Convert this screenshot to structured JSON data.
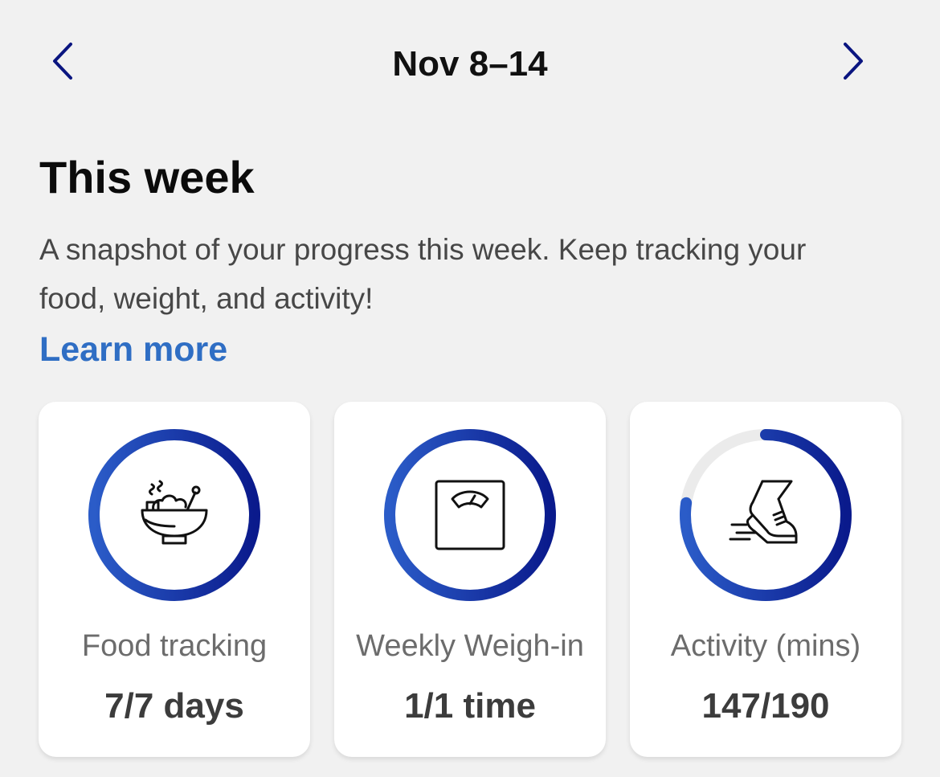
{
  "header": {
    "week_range": "Nov 8–14",
    "prev_icon": "chevron-left-icon",
    "next_icon": "chevron-right-icon"
  },
  "intro": {
    "title": "This week",
    "description": "A snapshot of your progress this week. Keep tracking your food, weight, and activity!",
    "learn_more": "Learn more"
  },
  "cards": [
    {
      "label": "Food tracking",
      "value": "7/7 days",
      "progress": 1.0,
      "icon": "food-bowl-icon"
    },
    {
      "label": "Weekly Weigh-in",
      "value": "1/1 time",
      "progress": 1.0,
      "icon": "scale-icon"
    },
    {
      "label": "Activity (mins)",
      "value": "147/190",
      "progress": 0.774,
      "icon": "sneaker-icon"
    }
  ],
  "colors": {
    "accent_link": "#2f6ec4",
    "nav_chevron": "#0a1580",
    "ring_top": "#2b5cc8",
    "ring_bottom": "#0a1a8c",
    "ring_track": "#ebebeb"
  }
}
